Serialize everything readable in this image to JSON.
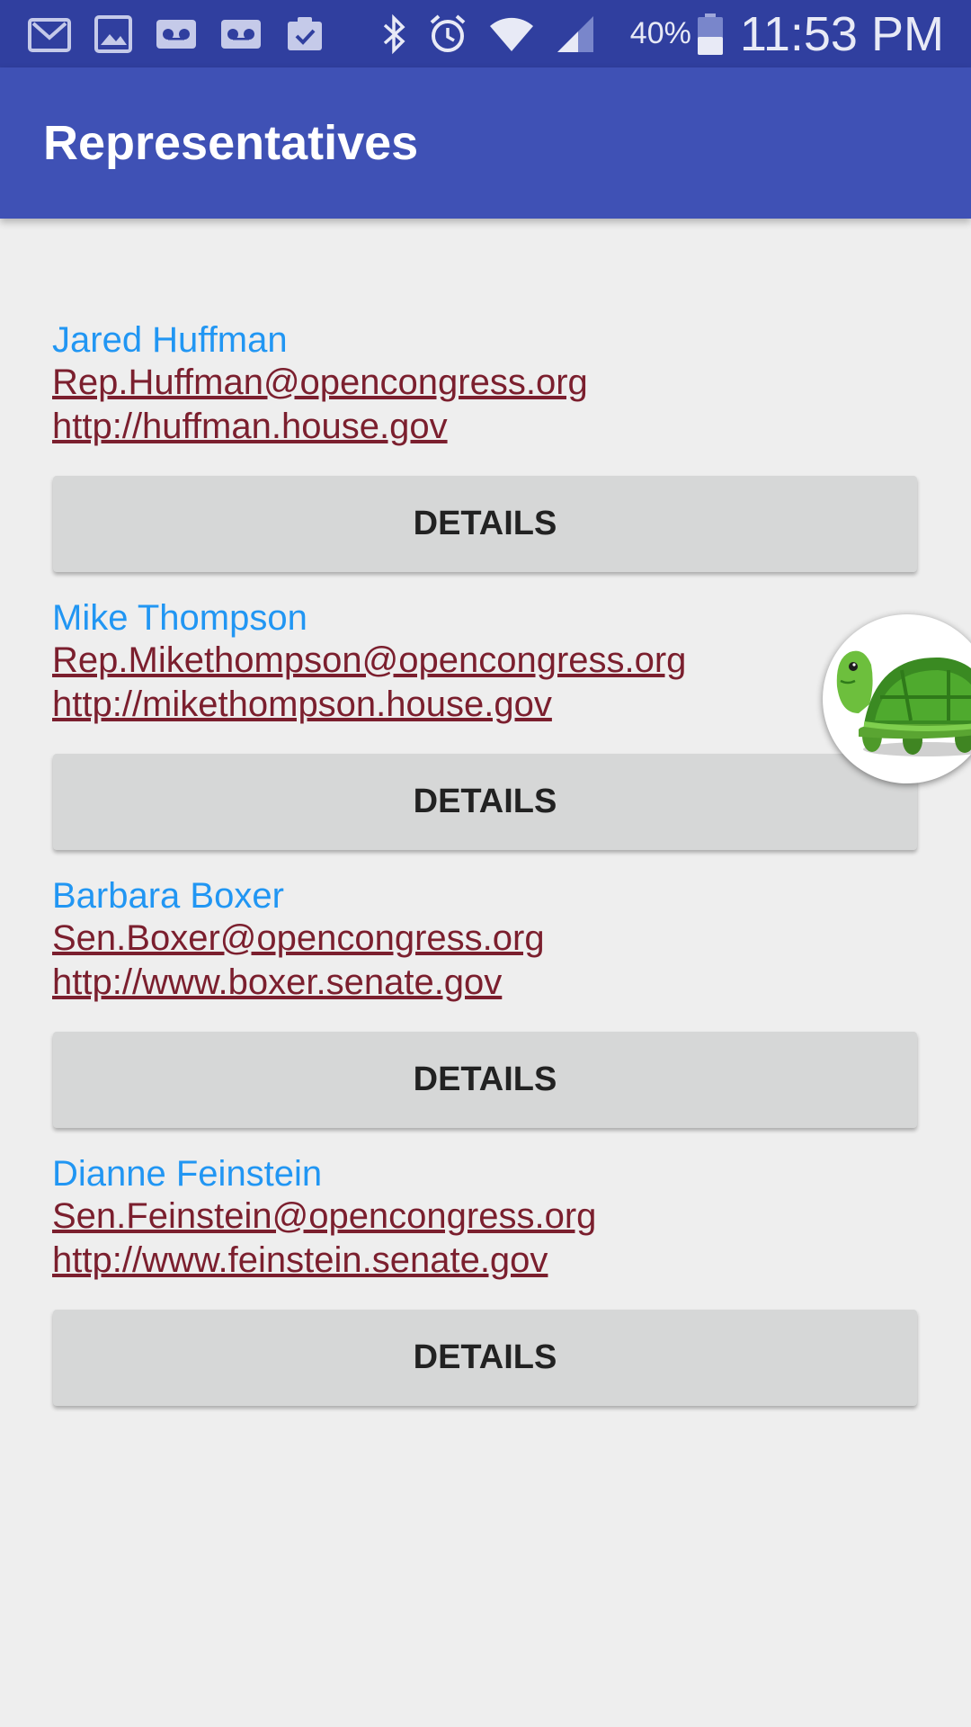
{
  "status_bar": {
    "battery": "40%",
    "time": "11:53 PM",
    "left_icons": [
      "gmail-icon",
      "gallery-icon",
      "voicemail-icon",
      "voicemail-icon",
      "clipboard-check-icon"
    ],
    "right_icons": [
      "bluetooth-icon",
      "alarm-icon",
      "wifi-icon",
      "signal-icon",
      "battery-icon"
    ]
  },
  "app_bar": {
    "title": "Representatives",
    "color": "#3f51b5"
  },
  "representatives": [
    {
      "name": "Jared Huffman",
      "email": "Rep.Huffman@opencongress.org",
      "website": "http://huffman.house.gov",
      "button": "DETAILS"
    },
    {
      "name": "Mike Thompson",
      "email": "Rep.Mikethompson@opencongress.org",
      "website": "http://mikethompson.house.gov",
      "button": "DETAILS"
    },
    {
      "name": "Barbara Boxer",
      "email": "Sen.Boxer@opencongress.org",
      "website": "http://www.boxer.senate.gov",
      "button": "DETAILS"
    },
    {
      "name": "Dianne Feinstein",
      "email": "Sen.Feinstein@opencongress.org",
      "website": "http://www.feinstein.senate.gov",
      "button": "DETAILS"
    }
  ],
  "floating_bubble": {
    "icon": "turtle-icon"
  },
  "colors": {
    "status_bar": "#303f9f",
    "name_text": "#2196f3",
    "link_text": "#7b1f2e",
    "button_bg": "#d6d7d7",
    "background": "#eeeeee"
  }
}
